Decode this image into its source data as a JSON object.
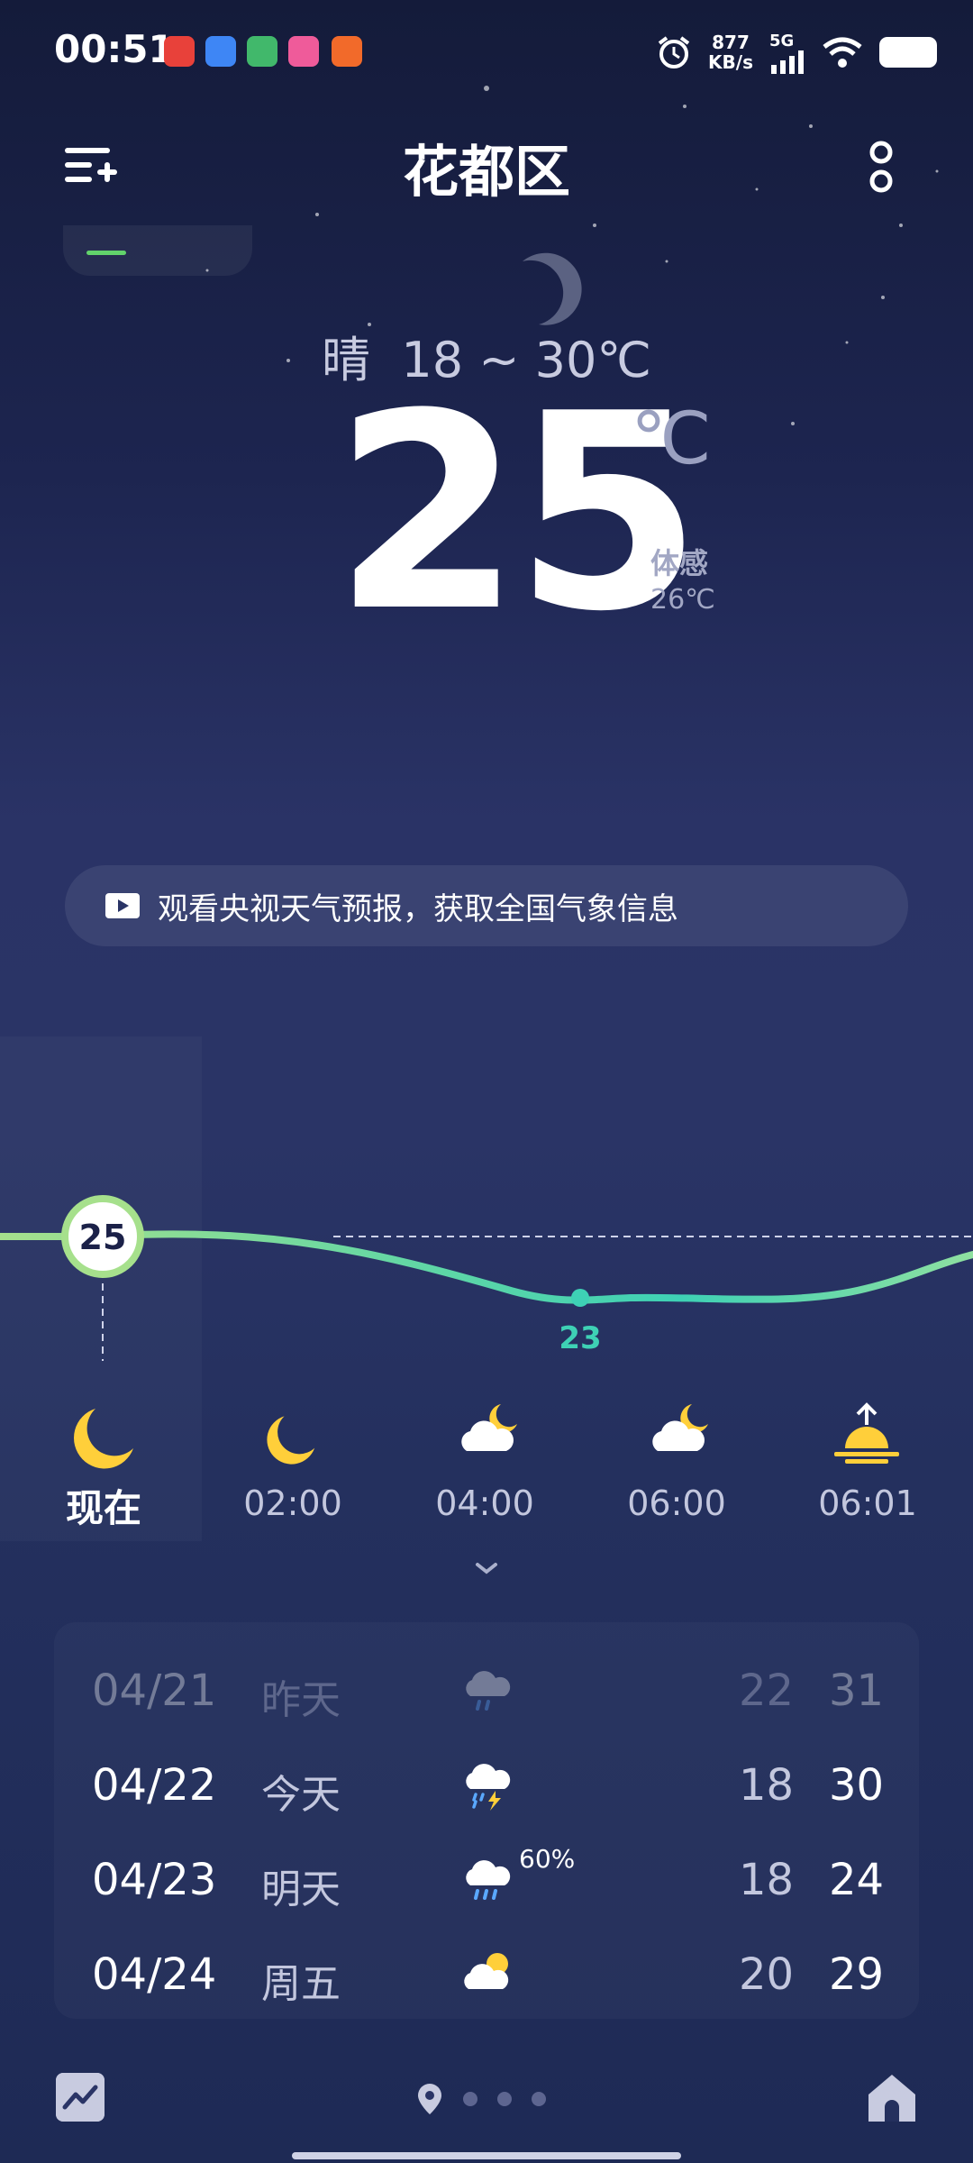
{
  "status_bar": {
    "time": "00:51",
    "net_speed_value": "877",
    "net_speed_unit": "KB/s",
    "network": "5G",
    "app_icons": [
      "toutiao-icon",
      "browser-icon",
      "video-icon",
      "bilibili-icon",
      "camera-icon"
    ]
  },
  "header": {
    "city": "花都区"
  },
  "current": {
    "condition": "晴",
    "range": "18 ~ 30℃",
    "temp": "25",
    "unit": "℃",
    "feels_label": "体感",
    "feels_value": "26℃"
  },
  "cctv_banner": {
    "text": "观看央视天气预报，获取全国气象信息"
  },
  "hourly": {
    "now_temp": "25",
    "min_temp": "23",
    "now_label": "现在",
    "items": [
      {
        "time": "02:00",
        "icon": "moon-icon"
      },
      {
        "time": "04:00",
        "icon": "cloudy-night-icon"
      },
      {
        "time": "06:00",
        "icon": "cloudy-night-icon"
      },
      {
        "time": "06:01",
        "icon": "sunrise-icon"
      }
    ]
  },
  "daily": [
    {
      "date": "04/21",
      "day": "昨天",
      "icon": "rain-cloud-icon",
      "prob": "",
      "low": "22",
      "high": "31"
    },
    {
      "date": "04/22",
      "day": "今天",
      "icon": "thunderstorm-icon",
      "prob": "",
      "low": "18",
      "high": "30"
    },
    {
      "date": "04/23",
      "day": "明天",
      "icon": "rain-cloud-icon",
      "prob": "60%",
      "low": "18",
      "high": "24"
    },
    {
      "date": "04/24",
      "day": "周五",
      "icon": "partly-cloudy-icon",
      "prob": "",
      "low": "20",
      "high": "29"
    }
  ],
  "colors": {
    "curve_start": "#a6e08c",
    "curve_end": "#3ed1b5",
    "moon": "#ffcf3a"
  }
}
